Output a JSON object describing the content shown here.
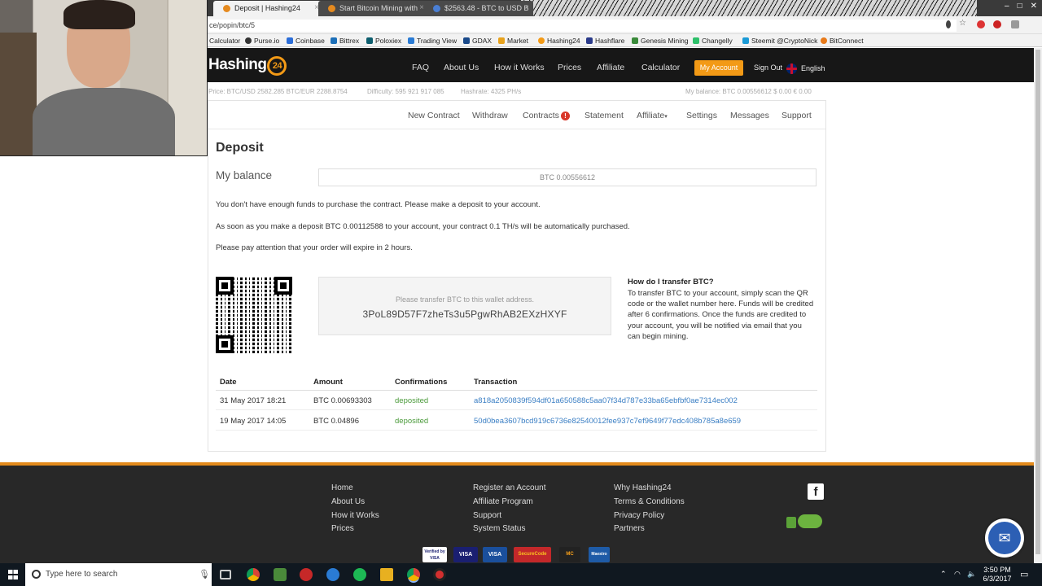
{
  "browser": {
    "tabs": [
      {
        "title": "Deposit | Hashing24"
      },
      {
        "title": "Start Bitcoin Mining with"
      },
      {
        "title": "$2563.48 - BTC to USD B"
      }
    ],
    "window_controls": [
      "–",
      "□",
      "✕"
    ],
    "url": "ce/popin/btc/5",
    "bookmarks": [
      "Calculator",
      "Purse.io",
      "Coinbase",
      "Bittrex",
      "Poloxiex",
      "Trading View",
      "GDAX",
      "Market",
      "Hashing24",
      "Hashflare",
      "Genesis Mining",
      "Changelly",
      "Steemit @CryptoNick",
      "BitConnect"
    ]
  },
  "site": {
    "logo_text": "Hashing",
    "logo_badge": "24",
    "nav": [
      "FAQ",
      "About Us",
      "How it Works",
      "Prices",
      "Affiliate",
      "Calculator"
    ],
    "my_account": "My Account",
    "sign_out": "Sign Out",
    "language": "English",
    "ticker": {
      "price": "Price:  BTC/USD 2582.285   BTC/EUR 2288.8754",
      "difficulty": "Difficulty: 595 921 917 085",
      "hashrate": "Hashrate: 4325 PH/s",
      "balance": "My balance:  BTC 0.00556612    $ 0.00    € 0.00"
    },
    "subnav": {
      "new_contract": "New Contract",
      "withdraw": "Withdraw",
      "contracts": "Contracts",
      "contracts_badge": "!",
      "statement": "Statement",
      "affiliate": "Affiliate",
      "settings": "Settings",
      "messages": "Messages",
      "support": "Support"
    }
  },
  "deposit": {
    "title": "Deposit",
    "balance_label": "My balance",
    "balance_value": "BTC 0.00556612",
    "msg1": "You don't have enough funds to purchase the contract. Please make a deposit to your account.",
    "msg2": "As soon as you make a deposit BTC 0.00112588 to your account, your contract 0.1 TH/s will be automatically purchased.",
    "msg3": "Please pay attention that your order will expire in 2 hours.",
    "wallet_hint": "Please transfer BTC to this wallet address.",
    "wallet_address": "3PoL89D57F7zheTs3u5PgwRhAB2EXzHXYF",
    "howto_title": "How do I transfer BTC?",
    "howto_text": "To transfer BTC to your account, simply scan the QR code or the wallet number here. Funds will be credited after 6 confirmations. Once the funds are credited to your account, you will be notified via email that you can begin mining."
  },
  "table": {
    "headers": [
      "Date",
      "Amount",
      "Confirmations",
      "Transaction"
    ],
    "rows": [
      {
        "date": "31 May 2017 18:21",
        "amount": "BTC 0.00693303",
        "status": "deposited",
        "tx": "a818a2050839f594df01a650588c5aa07f34d787e33ba65ebfbf0ae7314ec002"
      },
      {
        "date": "19 May 2017 14:05",
        "amount": "BTC 0.04896",
        "status": "deposited",
        "tx": "50d0bea3607bcd919c6736e82540012fee937c7ef9649f77edc408b785a8e659"
      }
    ]
  },
  "footer": {
    "col1": [
      "Home",
      "About Us",
      "How it Works",
      "Prices"
    ],
    "col2": [
      "Register an Account",
      "Affiliate Program",
      "Support",
      "System Status"
    ],
    "col3": [
      "Why Hashing24",
      "Terms & Conditions",
      "Privacy Policy",
      "Partners"
    ],
    "facebook": "f",
    "cards": [
      "Verified by VISA",
      "VISA",
      "VISA",
      "SecureCode",
      "MC",
      "Maestro"
    ],
    "chat_icon": "✉"
  },
  "taskbar": {
    "search_placeholder": "Type here to search",
    "time": "3:50 PM",
    "date": "6/3/2017"
  },
  "colors": {
    "accent": "#f39a16",
    "link": "#3b7fc4",
    "success": "#4a9a3a",
    "header_bg": "#171717",
    "footer_bg": "#282828"
  }
}
